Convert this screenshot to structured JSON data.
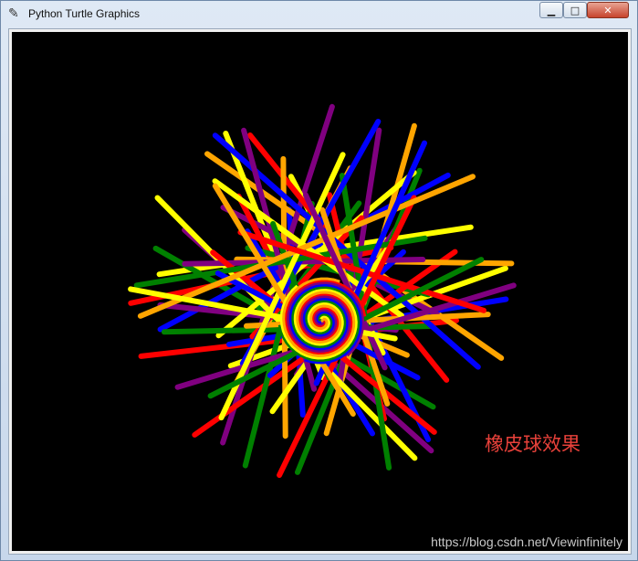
{
  "window": {
    "title": "Python Turtle Graphics",
    "buttons": {
      "minimize": "▁",
      "maximize": "□",
      "close": "✕"
    }
  },
  "canvas": {
    "background": "#000000",
    "caption": "橡皮球效果",
    "caption_color": "#e8413a",
    "watermark": "https://blog.csdn.net/Viewinfinitely",
    "drawing": {
      "description_icon": "turtle-star-spiral",
      "colors": [
        "red",
        "purple",
        "blue",
        "green",
        "yellow",
        "orange"
      ]
    }
  }
}
